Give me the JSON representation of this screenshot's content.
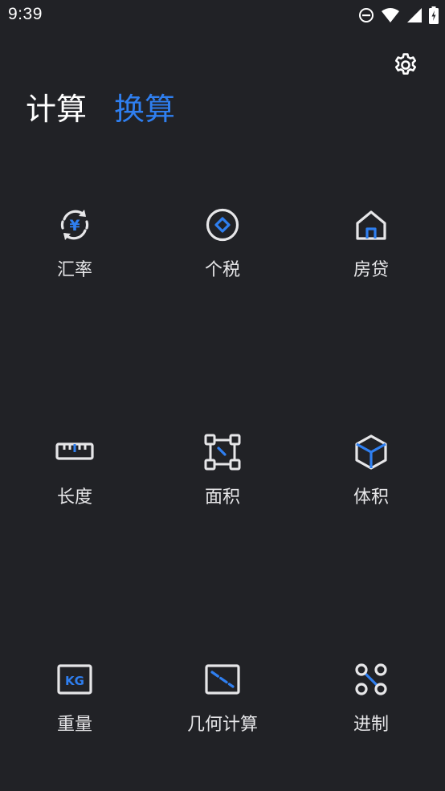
{
  "status_bar": {
    "time": "9:39",
    "icons": [
      "do-not-disturb-icon",
      "wifi-icon",
      "signal-icon",
      "battery-charging-icon"
    ]
  },
  "header": {
    "settings_icon": "gear-icon",
    "tabs": [
      {
        "label": "计算",
        "active": false
      },
      {
        "label": "换算",
        "active": true
      }
    ]
  },
  "grid": {
    "items": [
      {
        "label": "汇率",
        "icon": "currency-exchange-icon"
      },
      {
        "label": "个税",
        "icon": "tax-icon"
      },
      {
        "label": "房贷",
        "icon": "house-icon"
      },
      {
        "label": "长度",
        "icon": "ruler-icon"
      },
      {
        "label": "面积",
        "icon": "area-icon"
      },
      {
        "label": "体积",
        "icon": "cube-icon"
      },
      {
        "label": "重量",
        "icon": "weight-kg-icon"
      },
      {
        "label": "几何计算",
        "icon": "geometry-icon"
      },
      {
        "label": "进制",
        "icon": "number-base-icon"
      }
    ]
  },
  "colors": {
    "background": "#212226",
    "accent": "#2f7ff0",
    "icon_light": "#e6e6e8",
    "text": "#ffffff"
  },
  "icon_text": {
    "currency_symbol": "¥",
    "weight_unit": "KG"
  }
}
